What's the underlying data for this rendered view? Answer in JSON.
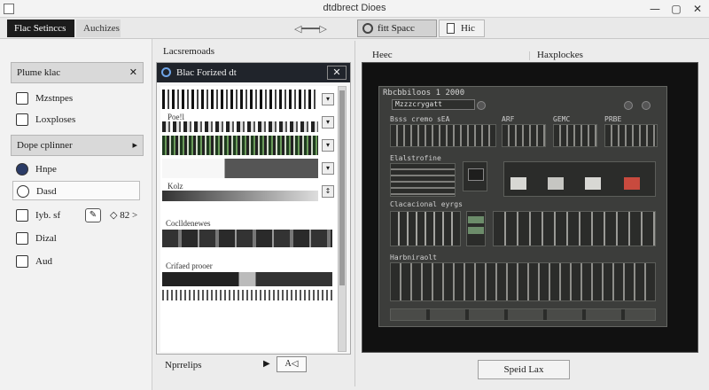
{
  "window": {
    "title": "dtdbrect Dioes",
    "controls": [
      "—",
      "▢",
      "✕"
    ]
  },
  "toolbar": {
    "tabs": [
      {
        "label": "Flac Setinccs",
        "active": true
      },
      {
        "label": "Auchizes",
        "active": false
      }
    ],
    "arrows": "◁━━━▷",
    "fit_label": "fitt Spacc",
    "hic_label": "Hic"
  },
  "sidebar": {
    "groups": [
      {
        "label": "Plume klac",
        "action": "✕"
      },
      {
        "label": "Dope cplinner",
        "action": "▸"
      }
    ],
    "items": [
      {
        "label": "Mzstnpes"
      },
      {
        "label": "Loxploses"
      },
      {
        "label": "Hnpe"
      },
      {
        "label": "Dasd"
      },
      {
        "label": "Iyb. sf",
        "extra": "◇ 82 >"
      },
      {
        "label": "Dizal"
      },
      {
        "label": "Aud"
      }
    ]
  },
  "middle": {
    "header": "Lacsremoads",
    "panel": {
      "title": "Blac Forized dt",
      "close": "✕",
      "rows": [
        {
          "label": ""
        },
        {
          "label": "Poe!l"
        },
        {
          "label": ""
        },
        {
          "label": ""
        },
        {
          "label": "Kolz"
        }
      ],
      "sections": [
        {
          "label": "Coclldenewes"
        },
        {
          "label": "Crifaed prooer"
        }
      ]
    },
    "footer_label": "Nprrelips",
    "footer_caret": "▶",
    "footer_button": "A◁"
  },
  "right": {
    "header_left": "Heec",
    "header_right": "Haxplockes",
    "screen": {
      "title": "Rbcbbiloos 1 2000",
      "field": "Mzzzcrygatt",
      "modules_a": [
        "Bsss cremo sEA",
        "ARF",
        "GEMC",
        "PRBE"
      ],
      "label_mid": "Elalstrofine",
      "label_mid2": "Clacacional eyrgs",
      "label_bottom": "Harbniraolt"
    },
    "bottom_button": "Speid Lax"
  },
  "colors": {
    "active_tab": "#1c1c1c",
    "panel_header": "#20242b",
    "accent_blue": "#6ea4e6",
    "pad_red": "#c84a3e"
  }
}
